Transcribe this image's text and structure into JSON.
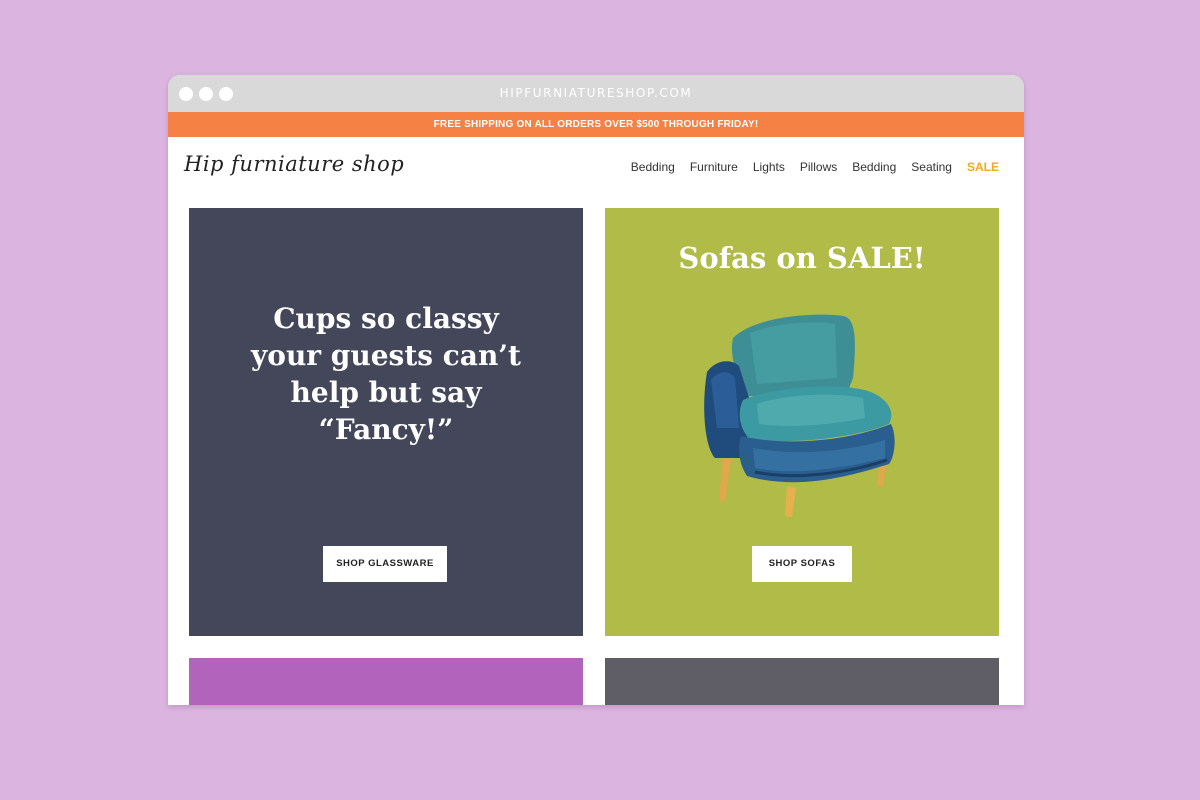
{
  "browser": {
    "url": "HIPFURNIATURESHOP.COM"
  },
  "promo": {
    "text": "FREE SHIPPING ON ALL ORDERS OVER $500 THROUGH FRIDAY!"
  },
  "header": {
    "logo": "Hip furniature shop",
    "nav": [
      {
        "label": "Bedding"
      },
      {
        "label": "Furniture"
      },
      {
        "label": "Lights"
      },
      {
        "label": "Pillows"
      },
      {
        "label": "Bedding"
      },
      {
        "label": "Seating"
      },
      {
        "label": "SALE"
      }
    ]
  },
  "cards": {
    "glassware": {
      "headline_lines": [
        "Cups so classy",
        "your guests can’t",
        "help but say",
        "“Fancy!”"
      ],
      "button": "SHOP GLASSWARE"
    },
    "sofas": {
      "headline": "Sofas on SALE!",
      "button": "SHOP SOFAS"
    }
  },
  "colors": {
    "background": "#dcb4e0",
    "promo": "#f58144",
    "sale": "#f5a623",
    "card_navy": "#434759",
    "card_green": "#b1bb47",
    "card_purple": "#b263bc",
    "card_gray": "#5f5d66"
  },
  "icons": {
    "window_controls": [
      "window-dot-icon",
      "window-dot-icon",
      "window-dot-icon"
    ],
    "product_image": "armchair-illustration"
  }
}
